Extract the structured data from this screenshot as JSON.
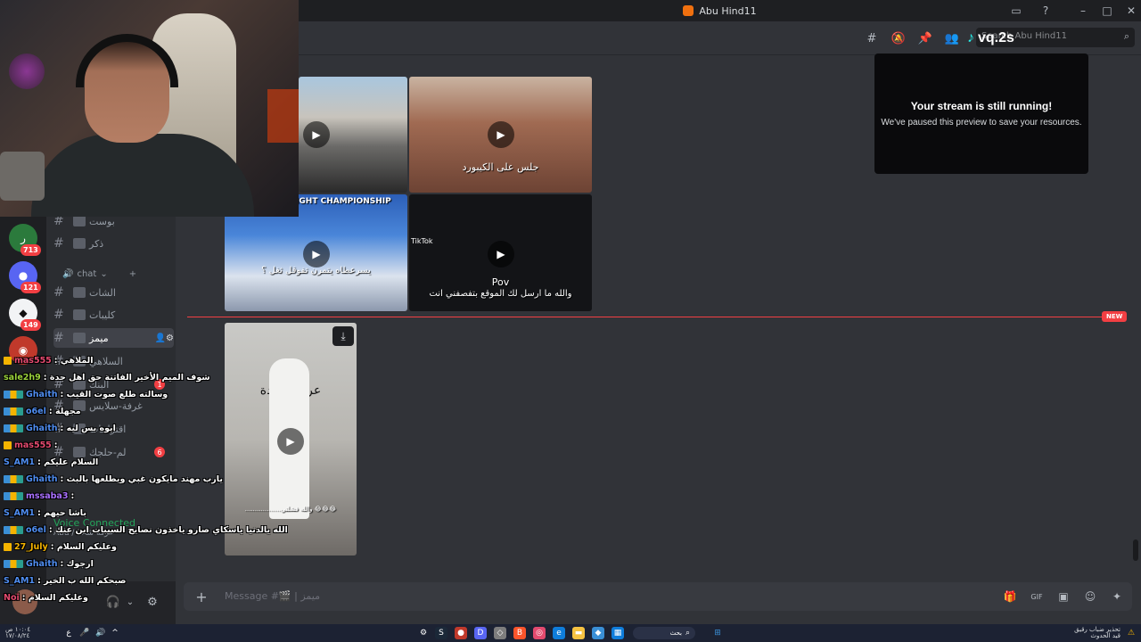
{
  "window": {
    "title": "Abu Hind11"
  },
  "search": {
    "placeholder": "Search Abu Hind11"
  },
  "watermark": {
    "text": "vq.2s"
  },
  "stream_panel": {
    "title": "Your stream is still running!",
    "subtitle": "We've paused this preview to save your resources."
  },
  "header_icons": [
    "threads-icon",
    "mute-icon",
    "pin-icon",
    "members-icon"
  ],
  "servers": [
    {
      "badge": "713"
    },
    {
      "badge": "121"
    },
    {
      "badge": "149"
    }
  ],
  "channels": [
    {
      "name": "بوست"
    },
    {
      "name": "ذكر"
    },
    {
      "name": "الشات"
    },
    {
      "name": "كليبات"
    },
    {
      "name": "ميمز",
      "active": true
    },
    {
      "name": "السلاهي"
    },
    {
      "name": "البنك"
    },
    {
      "name": "غرفة-سلايس"
    },
    {
      "name": "اقتراحات"
    },
    {
      "name": "لم-حلجك"
    }
  ],
  "channel_badges": [
    "1",
    "6"
  ],
  "category": {
    "name": "chat"
  },
  "voice": {
    "status": "Voice Connected",
    "channel": "Abu / غرفة شات"
  },
  "media": [
    {
      "caption": ""
    },
    {
      "caption": "جلس على الكيبورد"
    },
    {
      "caption": "يسرعطاه يتمرن تفوقل ثغل ؟",
      "banner": "SERVICE WEIGHT CHAMPIONSHIP"
    },
    {
      "caption_top": "Pov",
      "caption": "والله ما ارسل لك الموقع بتفصفني انت",
      "tiktok": "TikTok"
    },
    {
      "caption": "عربجية جدة",
      "bottom": "..................والله فشلتي 😂😂😂"
    }
  ],
  "new_divider": {
    "label": "NEW"
  },
  "composer": {
    "placeholder": "Message #🎬 | ميمز"
  },
  "chat_overlay": [
    {
      "user": "mas555",
      "color": "#e34a6f",
      "text": ": الملاهي"
    },
    {
      "user": "sale2h9",
      "color": "#9ad13b",
      "text": ": شوف الميم الأخير الفاتنة حق اهل جدة"
    },
    {
      "user": "Ghaith",
      "color": "#4f8df0",
      "text": ": وسالته طلع صوت القيب"
    },
    {
      "user": "o6el",
      "color": "#4f8df0",
      "text": ": مجهلة"
    },
    {
      "user": "Ghaith",
      "color": "#4f8df0",
      "text": ": ايوه بس ليه"
    },
    {
      "user": "mas555",
      "color": "#e34a6f",
      "text": ":"
    },
    {
      "user": "S_AM1",
      "color": "#4f8df0",
      "text": ": السلام عليكم"
    },
    {
      "user": "Ghaith",
      "color": "#4f8df0",
      "text": ": يارب مهند مايكون غبي ويطلعها بالبث"
    },
    {
      "user": "mssaba3",
      "color": "#a970ff",
      "text": ":"
    },
    {
      "user": "S_AM1",
      "color": "#4f8df0",
      "text": ": باشا حيهم"
    },
    {
      "user": "o6el",
      "color": "#4f8df0",
      "text": ": الله يالدنيا ياسكاي صارو ياخذون نصايح السيبات ابن عنك"
    },
    {
      "user": "27_July",
      "color": "#f5b400",
      "text": ": وعليكم السلام"
    },
    {
      "user": "Ghaith",
      "color": "#4f8df0",
      "text": ": ارجوك"
    },
    {
      "user": "S_AM1",
      "color": "#4f8df0",
      "text": ": صبحكم الله ب الخير"
    },
    {
      "user": "Noi",
      "color": "#e34a6f",
      "text": ": وعليكم السلام"
    }
  ],
  "taskbar": {
    "clock_time": "١٠:٠٤ ص",
    "clock_date": "١٧/٠٨/٢٤",
    "notif_line1": "تحذير ضباب رقيق",
    "notif_line2": "قيد الحدوث",
    "search_label": "بحث"
  }
}
